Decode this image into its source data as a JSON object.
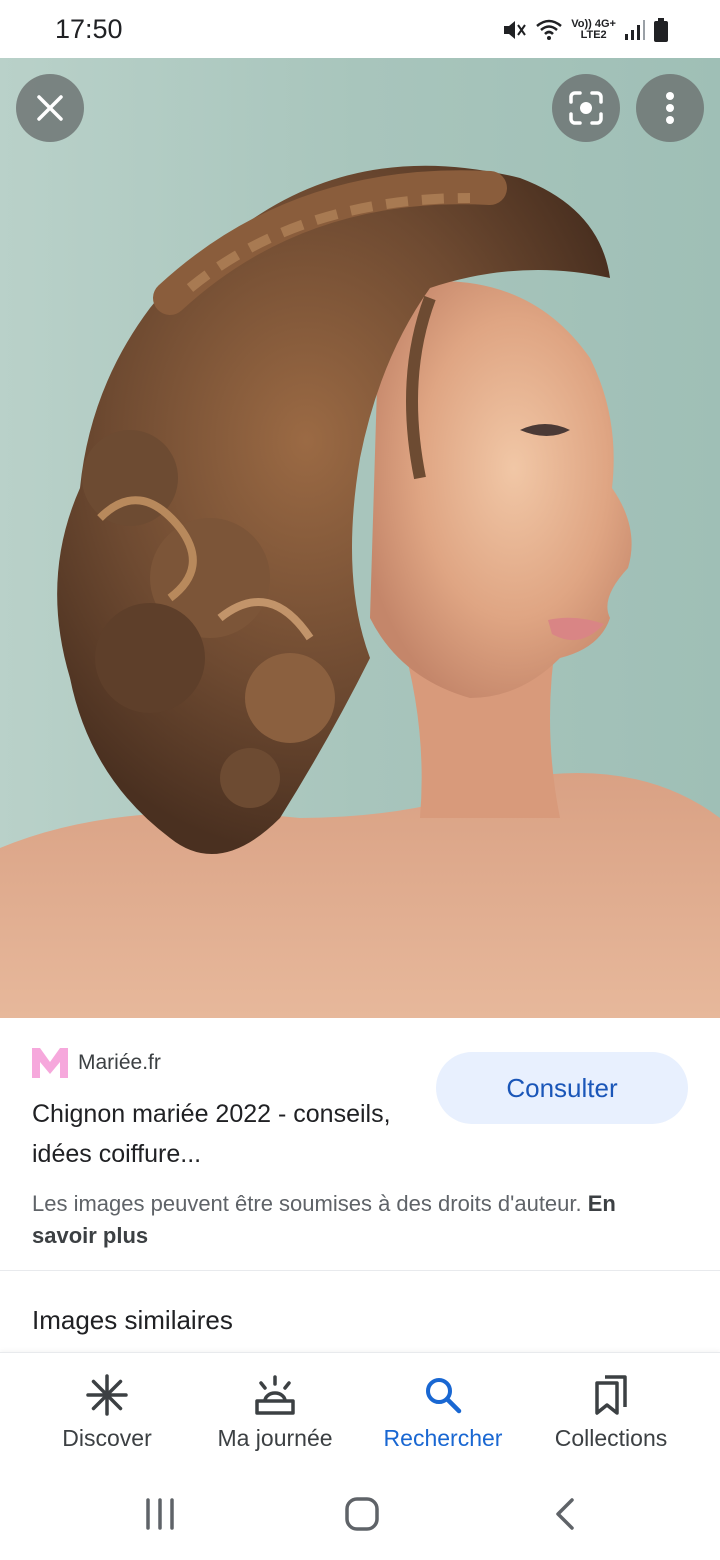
{
  "status_bar": {
    "time": "17:50",
    "network_top": "Vo)) 4G+",
    "network_bottom": "LTE2"
  },
  "viewer": {
    "close_icon": "close-icon",
    "lens_icon": "lens-icon",
    "more_icon": "more-vert-icon"
  },
  "result": {
    "source_logo": "M",
    "source_name": "Mariée.fr",
    "title": "Chignon mariée 2022 - conseils, idées coiffure...",
    "consult_label": "Consulter",
    "copyright_text": "Les images peuvent être soumises à des droits d'auteur.",
    "learn_more": "En savoir plus"
  },
  "similar": {
    "title": "Images similaires"
  },
  "bottom_nav": {
    "items": [
      {
        "label": "Discover",
        "icon": "asterisk-icon"
      },
      {
        "label": "Ma journée",
        "icon": "sunrise-icon"
      },
      {
        "label": "Rechercher",
        "icon": "search-icon"
      },
      {
        "label": "Collections",
        "icon": "bookmarks-icon"
      }
    ],
    "active_index": 2
  },
  "colors": {
    "accent": "#1967d2",
    "consult_bg": "#e8f0fe",
    "logo_pink": "#f6a8dc",
    "photo_bg": "#a9c6bd"
  }
}
